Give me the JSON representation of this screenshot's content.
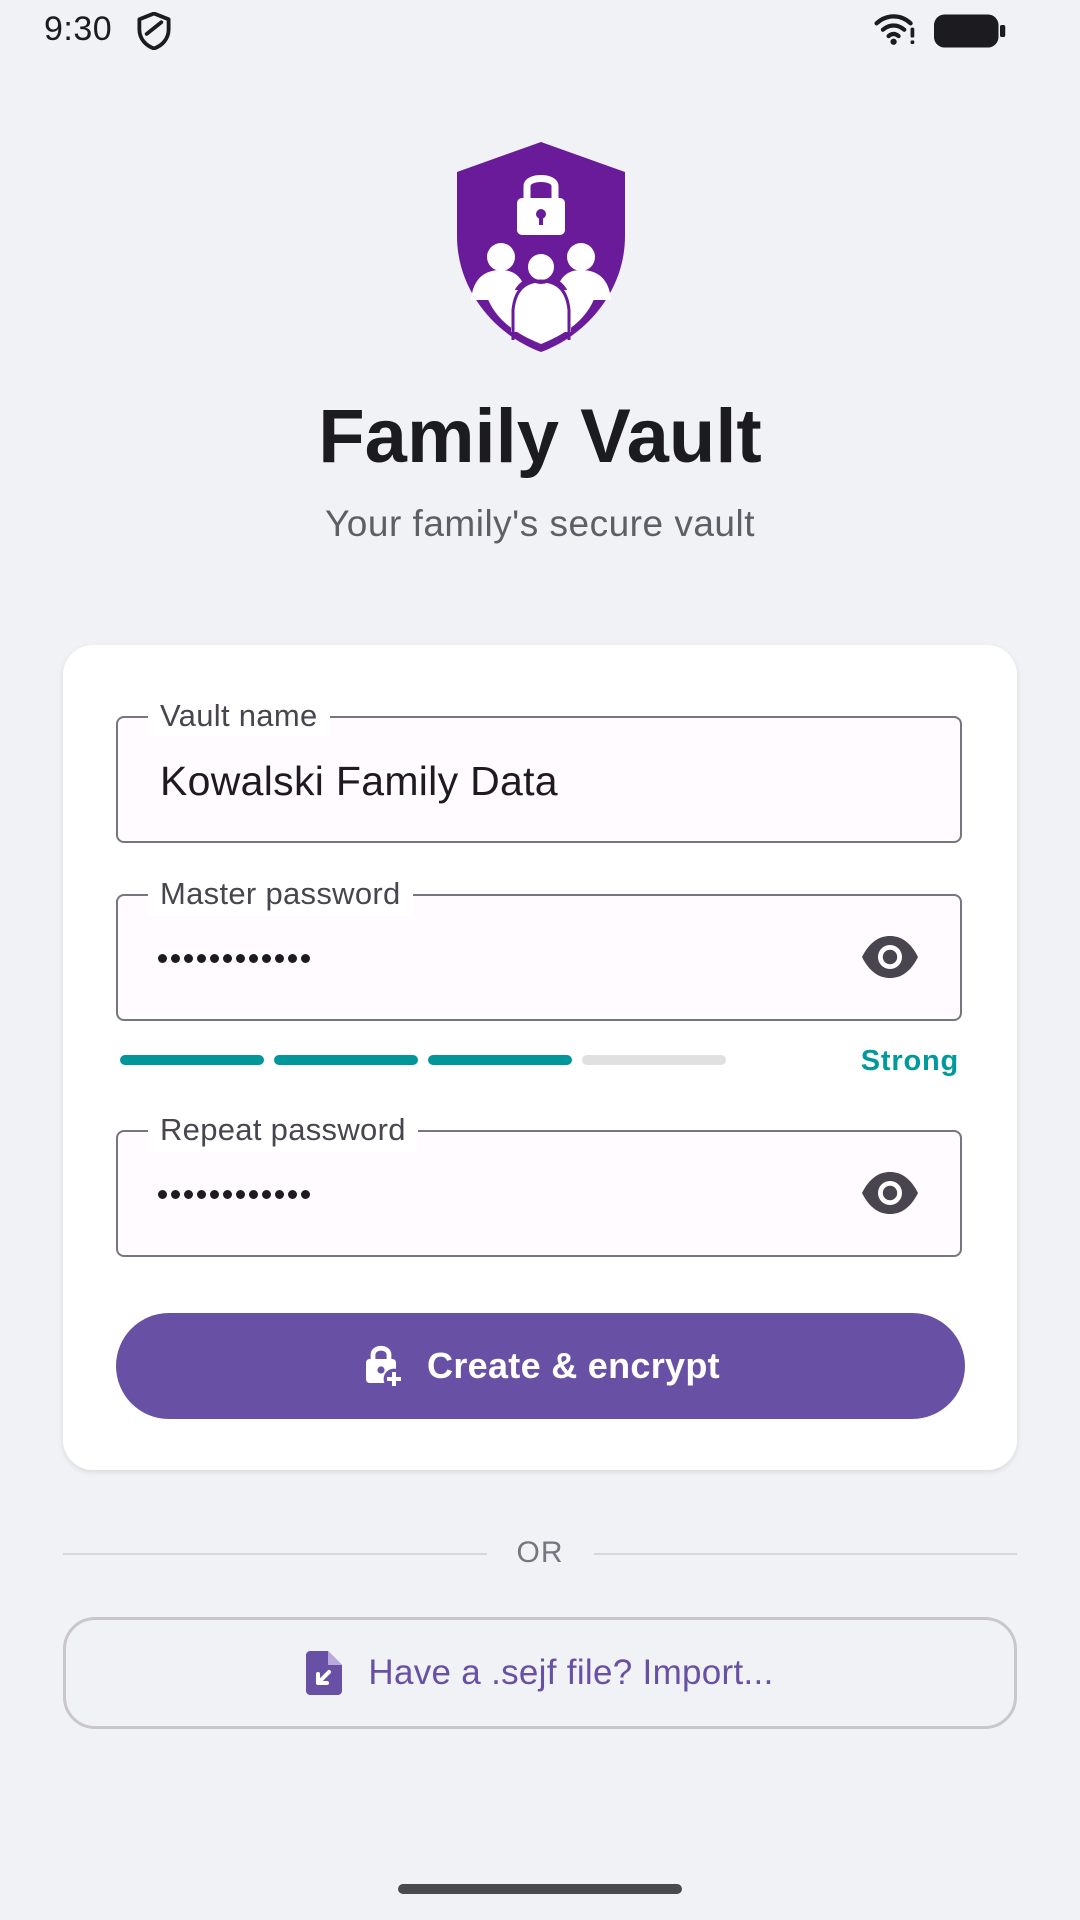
{
  "status_bar": {
    "time": "9:30",
    "icons": [
      "shield-icon",
      "wifi-icon",
      "battery-icon"
    ]
  },
  "header": {
    "logo": "family-shield-lock-logo",
    "title": "Family Vault",
    "subtitle": "Your family's secure vault"
  },
  "form": {
    "vault_name": {
      "label": "Vault name",
      "value": "Kowalski Family Data"
    },
    "master_password": {
      "label": "Master password",
      "masked_length": 12,
      "visibility_icon": "eye-icon"
    },
    "strength": {
      "filled": 3,
      "total": 4,
      "label": "Strong"
    },
    "repeat_password": {
      "label": "Repeat password",
      "masked_length": 12,
      "visibility_icon": "eye-icon"
    },
    "create_button": {
      "label": "Create & encrypt",
      "icon": "lock-add-icon"
    }
  },
  "divider_text": "OR",
  "import_button": {
    "label": "Have a .sejf file? Import...",
    "icon": "file-import-icon"
  },
  "colors": {
    "background": "#f1f2f6",
    "primary": "#6851a4",
    "logo_purple": "#6a1b9a",
    "strength_teal": "#00969a",
    "card": "#ffffff"
  }
}
